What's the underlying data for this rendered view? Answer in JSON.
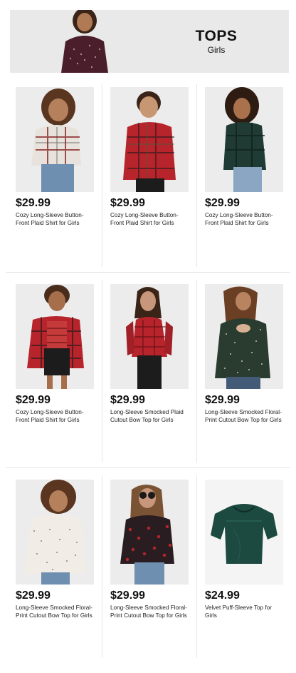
{
  "banner": {
    "title": "TOPS",
    "subtitle": "Girls"
  },
  "products": [
    {
      "price": "$29.99",
      "name_line1": "Cozy Long-Sleeve Button-",
      "name_line2": "Front Plaid Shirt for Girls"
    },
    {
      "price": "$29.99",
      "name_line1": "Cozy Long-Sleeve Button-",
      "name_line2": "Front Plaid Shirt for Girls"
    },
    {
      "price": "$29.99",
      "name_line1": "Cozy Long-Sleeve Button-",
      "name_line2": "Front Plaid Shirt for Girls"
    },
    {
      "price": "$29.99",
      "name_line1": "Cozy Long-Sleeve Button-",
      "name_line2": "Front Plaid Shirt for Girls"
    },
    {
      "price": "$29.99",
      "name_line1": "Long-Sleeve Smocked Plaid",
      "name_line2": "Cutout Bow Top for Girls"
    },
    {
      "price": "$29.99",
      "name_line1": "Long-Sleeve Smocked Floral-",
      "name_line2": "Print Cutout Bow Top for Girls"
    },
    {
      "price": "$29.99",
      "name_line1": "Long-Sleeve Smocked Floral-",
      "name_line2": "Print Cutout Bow Top for Girls"
    },
    {
      "price": "$29.99",
      "name_line1": "Long-Sleeve Smocked Floral-",
      "name_line2": "Print Cutout Bow Top for Girls"
    },
    {
      "price": "$24.99",
      "name_line1": "Velvet Puff-Sleeve Top for",
      "name_line2": "Girls"
    }
  ],
  "colors": {
    "white_plaid": "#e8e2dc",
    "red_plaid": "#b8242c",
    "green_plaid": "#1f3b33",
    "jeans": "#6f8fb1",
    "black": "#1c1c1c",
    "floral_dark": "#2a1d22",
    "cream_floral": "#f1ede6",
    "velvet_green": "#1d4a40"
  }
}
